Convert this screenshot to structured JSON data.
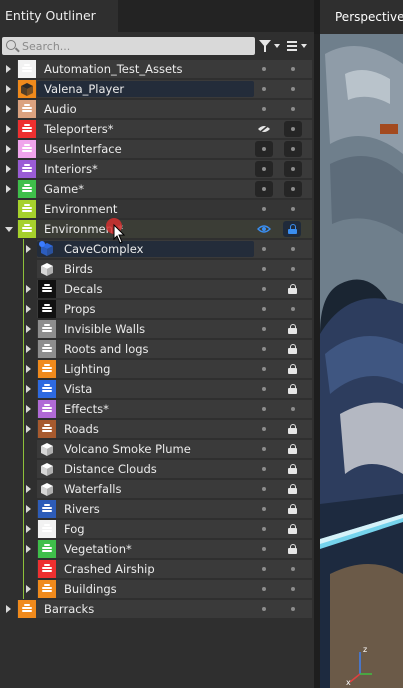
{
  "outliner": {
    "title": "Entity Outliner",
    "search_placeholder": "Search...",
    "icons": {
      "filter": "filter-icon",
      "menu": "menu-icon",
      "search": "search-icon"
    }
  },
  "viewport": {
    "title": "Perspective"
  },
  "colors": {
    "white": "#f2f2f2",
    "orange": "#f08a1c",
    "peach": "#dca27f",
    "red": "#ee3030",
    "pink": "#f0a4ec",
    "purple": "#9a5cd6",
    "green": "#3fbf4a",
    "lime": "#a6d12c",
    "black": "#111111",
    "gray": "#8e8e8e",
    "blue": "#2e6ae0",
    "lightpurple": "#b06ad6",
    "brown": "#a75a2e",
    "navy": "#2d5cb8",
    "yellow": "#f2c21a"
  },
  "rows": [
    {
      "label": "Automation_Test_Assets",
      "icon": "white",
      "kind": "slab",
      "level": 0,
      "lock": false,
      "expandable": true
    },
    {
      "label": "Valena_Player",
      "icon": "orange",
      "kind": "cube",
      "level": 0,
      "lock": false,
      "expandable": true,
      "highlight": true
    },
    {
      "label": "Audio",
      "icon": "peach",
      "kind": "slab",
      "level": 0,
      "lock": false,
      "expandable": true
    },
    {
      "label": "Teleporters*",
      "icon": "red",
      "kind": "slab",
      "level": 0,
      "lock": false,
      "expandable": true,
      "hidden": true
    },
    {
      "label": "UserInterface",
      "icon": "pink",
      "kind": "slab",
      "level": 0,
      "lock": false,
      "expandable": true,
      "boxes": true
    },
    {
      "label": "Interiors*",
      "icon": "purple",
      "kind": "slab",
      "level": 0,
      "lock": false,
      "expandable": true,
      "boxes": true
    },
    {
      "label": "Game*",
      "icon": "green",
      "kind": "slab",
      "level": 0,
      "lock": false,
      "expandable": true,
      "boxes": true
    },
    {
      "label": "Environment",
      "icon": "lime",
      "kind": "slab",
      "level": 0,
      "lock": false,
      "expandable": false
    },
    {
      "label": "Environment*",
      "icon": "lime",
      "kind": "slab",
      "level": 0,
      "lock": true,
      "expandable": true,
      "expanded": true,
      "special": true
    },
    {
      "label": "CaveComplex",
      "icon": "blue",
      "kind": "cube",
      "level": 1,
      "lock": false,
      "expandable": true,
      "highlight": true
    },
    {
      "label": "Birds",
      "icon": "white",
      "kind": "cube",
      "level": 1,
      "lock": false,
      "expandable": false
    },
    {
      "label": "Decals",
      "icon": "black",
      "kind": "slab",
      "level": 1,
      "lock": true,
      "expandable": true
    },
    {
      "label": "Props",
      "icon": "black",
      "kind": "slab",
      "level": 1,
      "lock": false,
      "expandable": true
    },
    {
      "label": "Invisible Walls",
      "icon": "gray",
      "kind": "slab",
      "level": 1,
      "lock": true,
      "expandable": true
    },
    {
      "label": "Roots and logs",
      "icon": "gray",
      "kind": "slab",
      "level": 1,
      "lock": true,
      "expandable": true
    },
    {
      "label": "Lighting",
      "icon": "orange",
      "kind": "slab",
      "level": 1,
      "lock": true,
      "expandable": true
    },
    {
      "label": "Vista",
      "icon": "blue",
      "kind": "slab",
      "level": 1,
      "lock": true,
      "expandable": true
    },
    {
      "label": "Effects*",
      "icon": "lightpurple",
      "kind": "slab",
      "level": 1,
      "lock": false,
      "expandable": true
    },
    {
      "label": "Roads",
      "icon": "brown",
      "kind": "slab",
      "level": 1,
      "lock": true,
      "expandable": true
    },
    {
      "label": "Volcano Smoke Plume",
      "icon": "white",
      "kind": "cube",
      "level": 1,
      "lock": true,
      "expandable": false
    },
    {
      "label": "Distance Clouds",
      "icon": "white",
      "kind": "cube",
      "level": 1,
      "lock": true,
      "expandable": false
    },
    {
      "label": "Waterfalls",
      "icon": "white",
      "kind": "cube",
      "level": 1,
      "lock": true,
      "expandable": true
    },
    {
      "label": "Rivers",
      "icon": "navy",
      "kind": "slab",
      "level": 1,
      "lock": true,
      "expandable": true
    },
    {
      "label": "Fog",
      "icon": "white",
      "kind": "slab",
      "level": 1,
      "lock": true,
      "expandable": true
    },
    {
      "label": "Vegetation*",
      "icon": "green",
      "kind": "slab",
      "level": 1,
      "lock": true,
      "expandable": true
    },
    {
      "label": "Crashed Airship",
      "icon": "red",
      "kind": "slab",
      "level": 1,
      "lock": false,
      "expandable": false
    },
    {
      "label": "Buildings",
      "icon": "orange",
      "kind": "slab",
      "level": 1,
      "lock": false,
      "expandable": true
    },
    {
      "label": "Barracks",
      "icon": "orange",
      "kind": "slab",
      "level": 0,
      "lock": false,
      "expandable": true
    }
  ]
}
